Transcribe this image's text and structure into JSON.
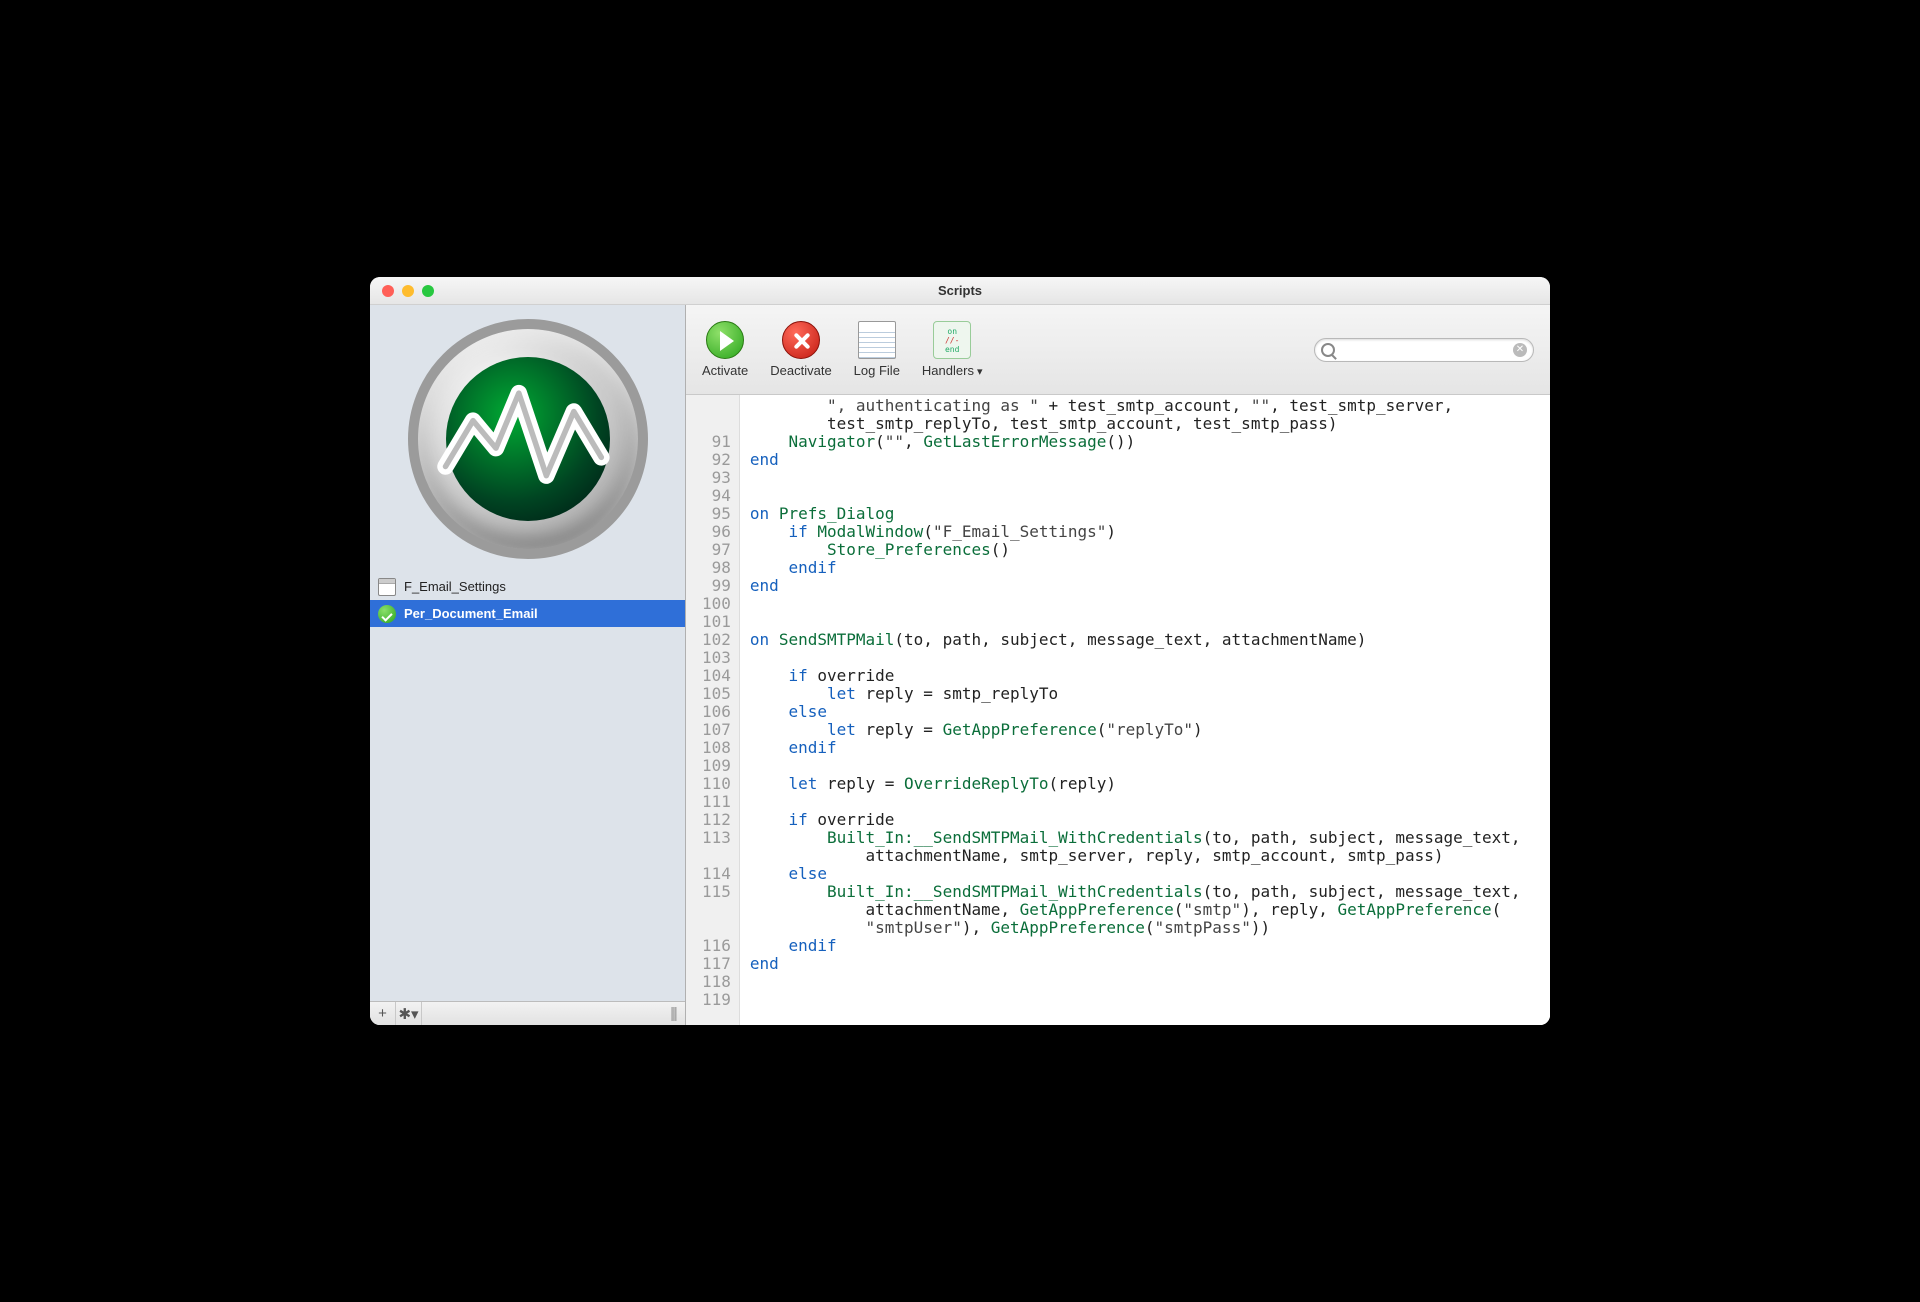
{
  "window": {
    "title": "Scripts"
  },
  "sidebar": {
    "items": [
      {
        "label": "F_Email_Settings",
        "selected": false,
        "icon": "window"
      },
      {
        "label": "Per_Document_Email",
        "selected": true,
        "icon": "check"
      }
    ],
    "footer": {
      "add": "+",
      "gear": "✱▾",
      "grip": "|||"
    }
  },
  "toolbar": {
    "activate": "Activate",
    "deactivate": "Deactivate",
    "logfile": "Log File",
    "handlers": "Handlers",
    "search_placeholder": ""
  },
  "editor": {
    "first_line_no": 91,
    "lines": [
      {
        "n": "",
        "frags": [
          {
            "t": "        "
          },
          {
            "t": "\", authenticating as \"",
            "c": "str"
          },
          {
            "t": " + test_smtp_account, "
          },
          {
            "t": "\"\"",
            "c": "str"
          },
          {
            "t": ", test_smtp_server,"
          }
        ]
      },
      {
        "n": "",
        "frags": [
          {
            "t": "        test_smtp_replyTo, test_smtp_account, test_smtp_pass)"
          }
        ]
      },
      {
        "n": 91,
        "frags": [
          {
            "t": "    "
          },
          {
            "t": "Navigator",
            "c": "fn"
          },
          {
            "t": "("
          },
          {
            "t": "\"\"",
            "c": "str"
          },
          {
            "t": ", "
          },
          {
            "t": "GetLastErrorMessage",
            "c": "fn"
          },
          {
            "t": "())"
          }
        ]
      },
      {
        "n": 92,
        "frags": [
          {
            "t": "end",
            "c": "kw"
          }
        ]
      },
      {
        "n": 93,
        "frags": [
          {
            "t": ""
          }
        ]
      },
      {
        "n": 94,
        "frags": [
          {
            "t": ""
          }
        ]
      },
      {
        "n": 95,
        "frags": [
          {
            "t": "on ",
            "c": "kw"
          },
          {
            "t": "Prefs_Dialog",
            "c": "fn"
          }
        ]
      },
      {
        "n": 96,
        "frags": [
          {
            "t": "    "
          },
          {
            "t": "if",
            "c": "kw"
          },
          {
            "t": " "
          },
          {
            "t": "ModalWindow",
            "c": "fn"
          },
          {
            "t": "("
          },
          {
            "t": "\"F_Email_Settings\"",
            "c": "str"
          },
          {
            "t": ")"
          }
        ]
      },
      {
        "n": 97,
        "frags": [
          {
            "t": "        "
          },
          {
            "t": "Store_Preferences",
            "c": "fn"
          },
          {
            "t": "()"
          }
        ]
      },
      {
        "n": 98,
        "frags": [
          {
            "t": "    "
          },
          {
            "t": "endif",
            "c": "kw"
          }
        ]
      },
      {
        "n": 99,
        "frags": [
          {
            "t": "end",
            "c": "kw"
          }
        ]
      },
      {
        "n": 100,
        "frags": [
          {
            "t": ""
          }
        ]
      },
      {
        "n": 101,
        "frags": [
          {
            "t": ""
          }
        ]
      },
      {
        "n": 102,
        "frags": [
          {
            "t": "on ",
            "c": "kw"
          },
          {
            "t": "SendSMTPMail",
            "c": "fn"
          },
          {
            "t": "(to, path, subject, message_text, attachmentName)"
          }
        ]
      },
      {
        "n": 103,
        "frags": [
          {
            "t": ""
          }
        ]
      },
      {
        "n": 104,
        "frags": [
          {
            "t": "    "
          },
          {
            "t": "if",
            "c": "kw"
          },
          {
            "t": " override"
          }
        ]
      },
      {
        "n": 105,
        "frags": [
          {
            "t": "        "
          },
          {
            "t": "let",
            "c": "kw"
          },
          {
            "t": " reply = smtp_replyTo"
          }
        ]
      },
      {
        "n": 106,
        "frags": [
          {
            "t": "    "
          },
          {
            "t": "else",
            "c": "kw"
          }
        ]
      },
      {
        "n": 107,
        "frags": [
          {
            "t": "        "
          },
          {
            "t": "let",
            "c": "kw"
          },
          {
            "t": " reply = "
          },
          {
            "t": "GetAppPreference",
            "c": "fn"
          },
          {
            "t": "("
          },
          {
            "t": "\"replyTo\"",
            "c": "str"
          },
          {
            "t": ")"
          }
        ]
      },
      {
        "n": 108,
        "frags": [
          {
            "t": "    "
          },
          {
            "t": "endif",
            "c": "kw"
          }
        ]
      },
      {
        "n": 109,
        "frags": [
          {
            "t": ""
          }
        ]
      },
      {
        "n": 110,
        "frags": [
          {
            "t": "    "
          },
          {
            "t": "let",
            "c": "kw"
          },
          {
            "t": " reply = "
          },
          {
            "t": "OverrideReplyTo",
            "c": "fn"
          },
          {
            "t": "(reply)"
          }
        ]
      },
      {
        "n": 111,
        "frags": [
          {
            "t": ""
          }
        ]
      },
      {
        "n": 112,
        "frags": [
          {
            "t": "    "
          },
          {
            "t": "if",
            "c": "kw"
          },
          {
            "t": " override"
          }
        ]
      },
      {
        "n": 113,
        "frags": [
          {
            "t": "        "
          },
          {
            "t": "Built_In:__SendSMTPMail_WithCredentials",
            "c": "fn"
          },
          {
            "t": "(to, path, subject, message_text,"
          }
        ]
      },
      {
        "n": "",
        "frags": [
          {
            "t": "            attachmentName, smtp_server, reply, smtp_account, smtp_pass)"
          }
        ]
      },
      {
        "n": 114,
        "frags": [
          {
            "t": "    "
          },
          {
            "t": "else",
            "c": "kw"
          }
        ]
      },
      {
        "n": 115,
        "frags": [
          {
            "t": "        "
          },
          {
            "t": "Built_In:__SendSMTPMail_WithCredentials",
            "c": "fn"
          },
          {
            "t": "(to, path, subject, message_text,"
          }
        ]
      },
      {
        "n": "",
        "frags": [
          {
            "t": "            attachmentName, "
          },
          {
            "t": "GetAppPreference",
            "c": "fn"
          },
          {
            "t": "("
          },
          {
            "t": "\"smtp\"",
            "c": "str"
          },
          {
            "t": "), reply, "
          },
          {
            "t": "GetAppPreference",
            "c": "fn"
          },
          {
            "t": "("
          }
        ]
      },
      {
        "n": "",
        "frags": [
          {
            "t": "            "
          },
          {
            "t": "\"smtpUser\"",
            "c": "str"
          },
          {
            "t": "), "
          },
          {
            "t": "GetAppPreference",
            "c": "fn"
          },
          {
            "t": "("
          },
          {
            "t": "\"smtpPass\"",
            "c": "str"
          },
          {
            "t": "))"
          }
        ]
      },
      {
        "n": 116,
        "frags": [
          {
            "t": "    "
          },
          {
            "t": "endif",
            "c": "kw"
          }
        ]
      },
      {
        "n": 117,
        "frags": [
          {
            "t": "end",
            "c": "kw"
          }
        ]
      },
      {
        "n": 118,
        "frags": [
          {
            "t": ""
          }
        ]
      },
      {
        "n": 119,
        "frags": [
          {
            "t": ""
          }
        ]
      }
    ]
  }
}
